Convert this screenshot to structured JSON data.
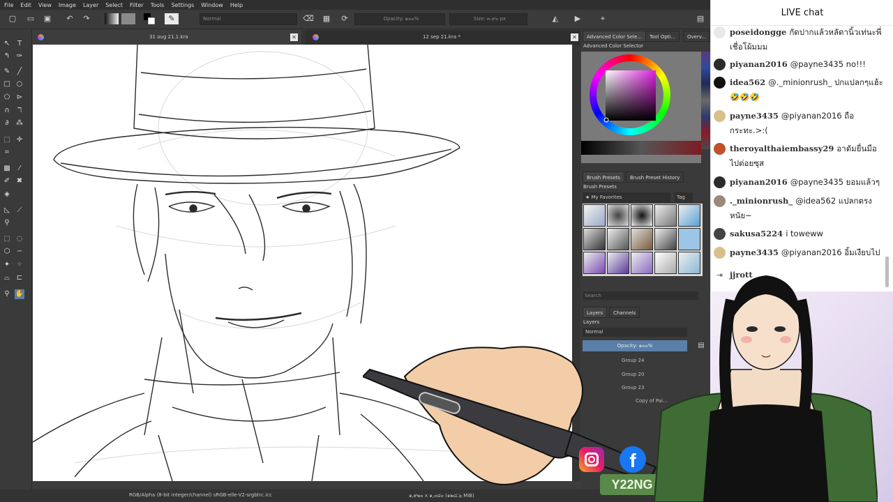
{
  "menu": [
    "File",
    "Edit",
    "View",
    "Image",
    "Layer",
    "Select",
    "Filter",
    "Tools",
    "Settings",
    "Window",
    "Help"
  ],
  "toolbar": {
    "blend_mode": "Normal",
    "opacity": "Opacity: ๑๐๐%",
    "size": "Size: ๓.๙๐ px"
  },
  "tabs": [
    {
      "title": "31 aug 21.1.kra"
    },
    {
      "title": "12 sep 21.kra *"
    }
  ],
  "status": {
    "color_space": "RGB/Alpha (8-bit integer/channel)  sRGB-elle-V2-srgbtrc.icc",
    "dimensions": "๑,๙๒๐ x ๑,๐๘๐ (๑๒๘.๖ MiB)"
  },
  "dock": {
    "top_tabs": [
      "Advanced Color Sele...",
      "Tool Opti...",
      "Overv..."
    ],
    "color_selector_title": "Advanced Color Selector",
    "brush_tabs": [
      "Brush Presets",
      "Brush Preset History"
    ],
    "brush_title": "Brush Presets",
    "favorites": "My Favorites",
    "tag": "Tag",
    "search": "Search",
    "layer_tabs": [
      "Layers",
      "Channels"
    ],
    "layers_title": "Layers",
    "layer_blend": "Normal",
    "layer_opacity": "Opacity: ๑๐๐%",
    "layers": [
      {
        "name": "Group 24"
      },
      {
        "name": "Group 20"
      },
      {
        "name": "Group 23"
      },
      {
        "name": "Copy of Pai..."
      }
    ]
  },
  "chat": {
    "title": "LIVE chat",
    "messages": [
      {
        "user": "poseidongge",
        "text": "กัดปากแล้วหลัดานิ้วเท่นะพี่เชื่อโผ้มมม",
        "avatar_color": "#cfcfcf"
      },
      {
        "user": "piyanan2016",
        "text": "@payne3435 no!!!",
        "avatar_color": "#2b2b2b"
      },
      {
        "user": "idea562",
        "text": "@._minionrush_ ปกแปลกๆแฮ้ะ🤣🤣🤣",
        "avatar_color": "#111111"
      },
      {
        "user": "payne3435",
        "text": "@piyanan2016 ถือกระทะ.>:(",
        "avatar_color": "#d8c08a"
      },
      {
        "user": "theroyalthaiembassy29",
        "text": "อาดัมยื่นมือไปต่อยซุส",
        "avatar_color": "#c0502a"
      },
      {
        "user": "piyanan2016",
        "text": "@payne3435 ยอมแล้วๆ",
        "avatar_color": "#2b2b2b"
      },
      {
        "user": "._minionrush_",
        "text": "@idea562 แปลกตรงหนัย~",
        "avatar_color": "#9a8a7a"
      },
      {
        "user": "sakusa5224",
        "text": "i toweww",
        "avatar_color": "#444444"
      },
      {
        "user": "payne3435",
        "text": "@piyanan2016 อิ้มเงียบไป",
        "avatar_color": "#d8c08a"
      },
      {
        "user": "jjrott",
        "text": "",
        "avatar_color": "#ffffff"
      }
    ]
  },
  "overlay": {
    "brand": "Y22NG"
  },
  "colors": {
    "krita_bg": "#3c3c3c",
    "canvas": "#ffffff",
    "instagram": "#c13584",
    "facebook": "#1877f2",
    "twitter": "#1da1f2",
    "brand_badge": "#5a8a4a"
  }
}
